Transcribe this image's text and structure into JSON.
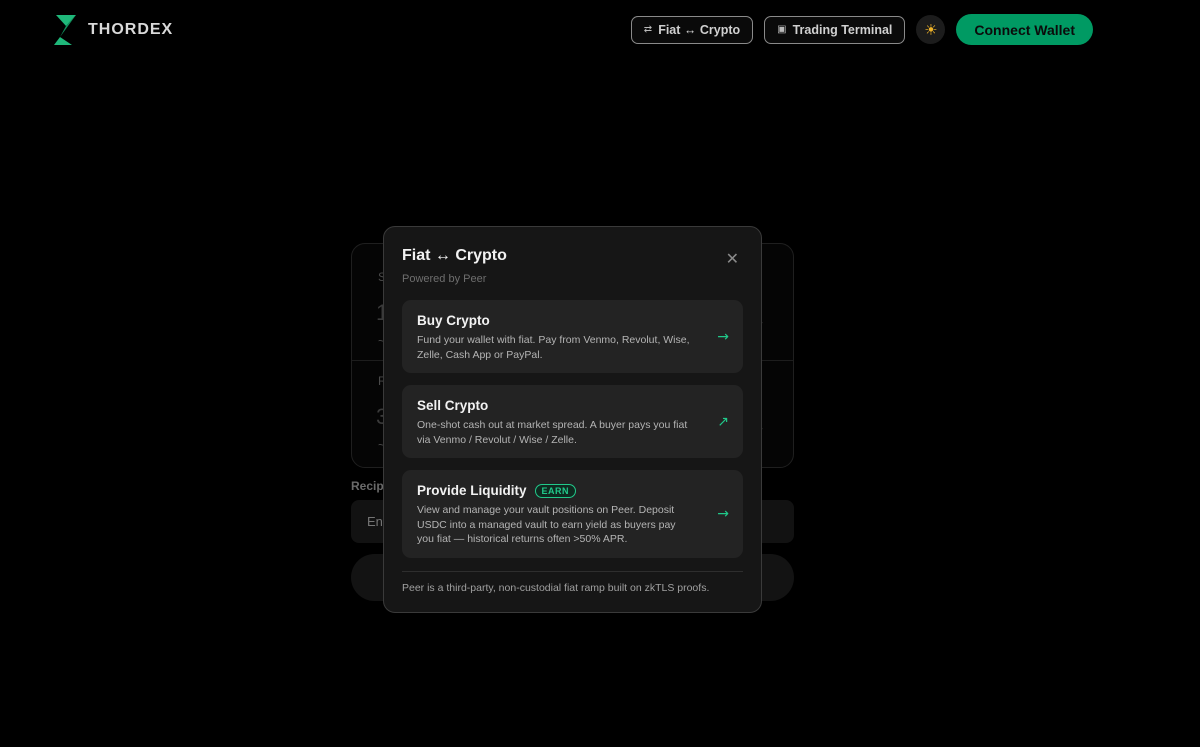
{
  "app": {
    "brand": "THORDEX",
    "accent_color": "#009a63"
  },
  "header": {
    "fiat_button": {
      "icon": "swap-icon",
      "label": "Fiat ↔ Crypto"
    },
    "terminal_button": {
      "icon": "chart-icon",
      "label": "Trading Terminal"
    },
    "theme_toggle": {
      "icon": "sun-icon"
    },
    "connect_label": "Connect Wallet"
  },
  "background": {
    "sell_label_fragment": "S",
    "sell_amount_fragment": "1",
    "sell_usd_fragment": "~",
    "receive_label_fragment": "R",
    "receive_amount_fragment": "3",
    "receive_usd_fragment": "~",
    "recipient_label": "Recip",
    "recipient_placeholder": "En"
  },
  "modal": {
    "title": "Fiat ↔ Crypto",
    "subtitle": "Powered by Peer",
    "options": [
      {
        "title": "Buy Crypto",
        "description": "Fund your wallet with fiat. Pay from Venmo, Revolut, Wise, Zelle, Cash App or PayPal.",
        "arrow": "→",
        "arrow_icon": "arrow-right-icon"
      },
      {
        "title": "Sell Crypto",
        "description": "One-shot cash out at market spread. A buyer pays you fiat via Venmo / Revolut / Wise / Zelle.",
        "arrow": "↗",
        "arrow_icon": "arrow-up-right-icon"
      },
      {
        "title": "Provide Liquidity",
        "badge": "EARN",
        "description": "View and manage your vault positions on Peer. Deposit USDC into a managed vault to earn yield as buyers pay you fiat — historical returns often >50% APR.",
        "arrow": "→",
        "arrow_icon": "arrow-right-icon"
      }
    ],
    "footer": "Peer is a third-party, non-custodial fiat ramp built on zkTLS proofs."
  }
}
